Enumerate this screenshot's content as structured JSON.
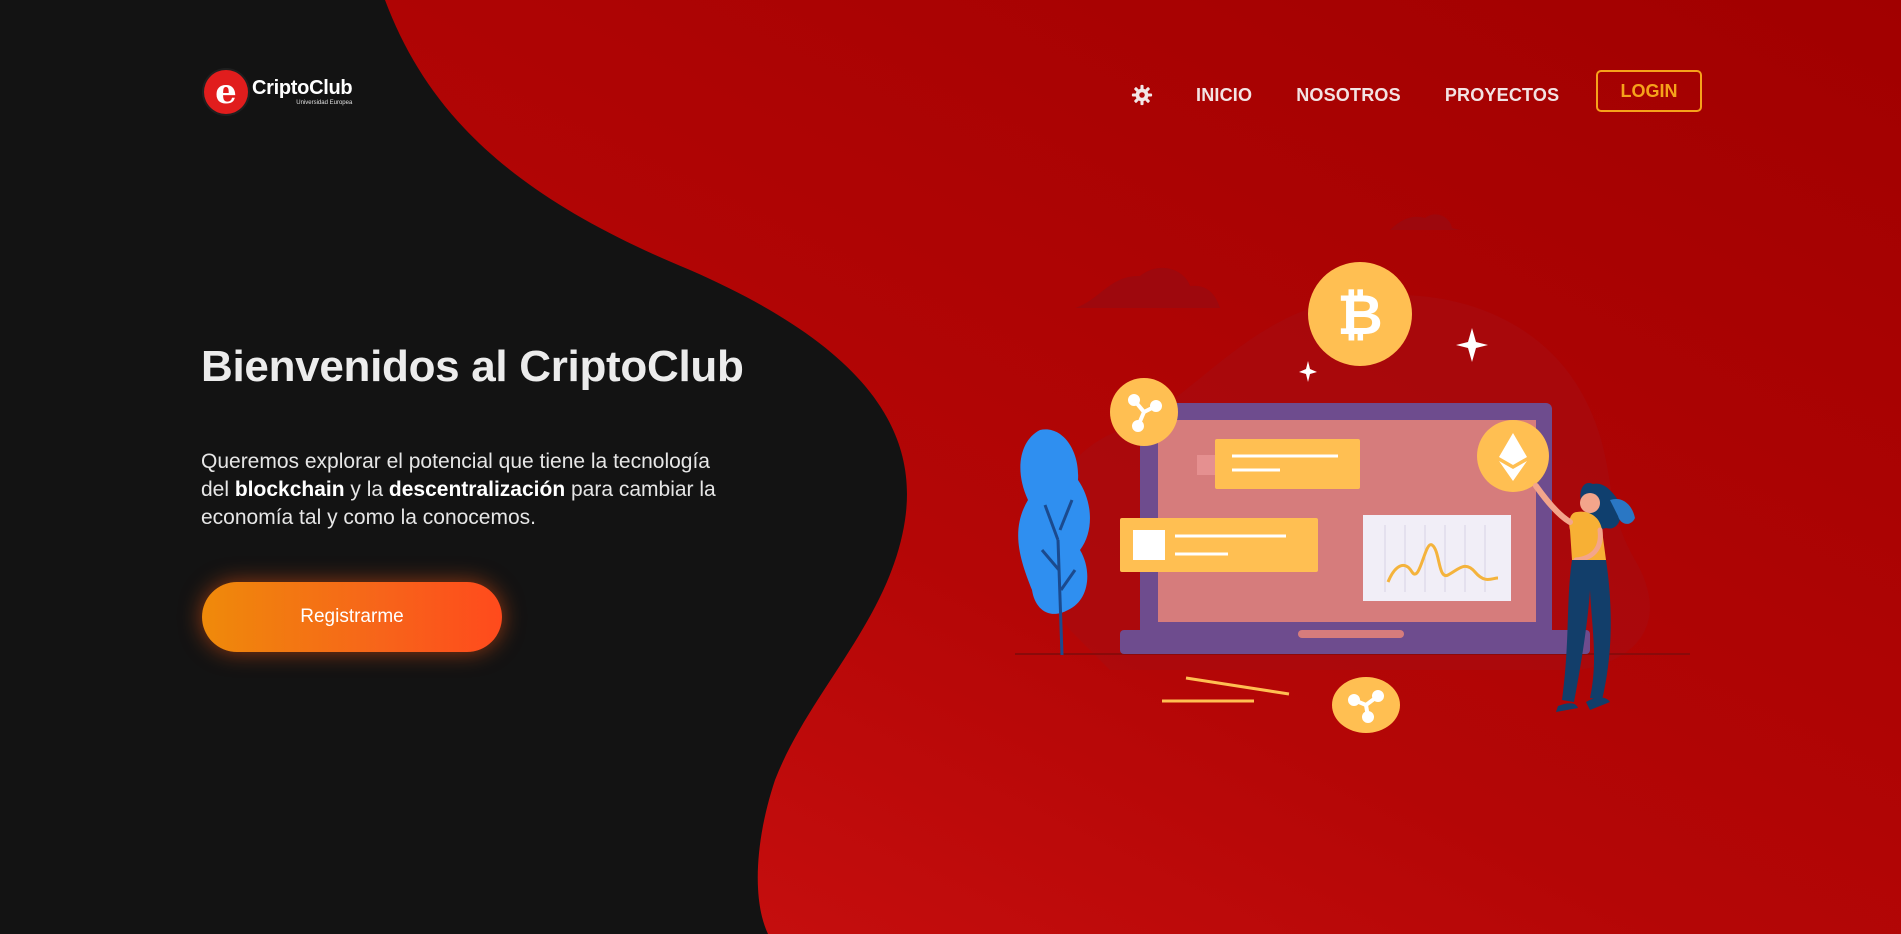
{
  "brand": {
    "logo_letter": "e",
    "name": "CriptoClub",
    "subtitle": "Universidad Europea"
  },
  "nav": {
    "settings_icon": "gear-icon",
    "links": [
      "INICIO",
      "NOSOTROS",
      "PROYECTOS"
    ],
    "login_label": "LOGIN"
  },
  "hero": {
    "title": "Bienvenidos al CriptoClub",
    "text_1": "Queremos explorar el potencial que tiene la tecnología del ",
    "bold_1": "blockchain",
    "text_2": " y la ",
    "bold_2": "descentralización",
    "text_3": " para cambiar la economía tal y como la conocemos.",
    "cta_label": "Registrarme"
  },
  "illustration": {
    "icons": [
      "bitcoin-icon",
      "ethereum-icon",
      "ripple-icon",
      "laptop-icon",
      "plant-icon",
      "woman-figure"
    ]
  },
  "colors": {
    "dark_bg": "#131313",
    "red_bg": "#c10a0a",
    "accent_orange": "#f6a21b",
    "coin_yellow": "#ffbf52"
  }
}
